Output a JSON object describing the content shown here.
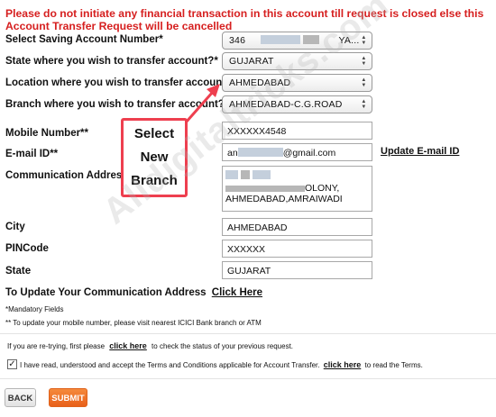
{
  "warning": "Please do not initiate any financial transaction in this account till request is closed else this Account Transfer Request will be cancelled",
  "form": {
    "saving_account_label": "Select Saving Account Number*",
    "saving_account_prefix": "346",
    "saving_account_suffix": "YA...",
    "state_label": "State where you wish to transfer account?*",
    "state_value": "GUJARAT",
    "location_label": "Location where you wish to transfer account?*",
    "location_value": "AHMEDABAD",
    "branch_label": "Branch where you wish to transfer account?*",
    "branch_value": "AHMEDABAD-C.G.ROAD",
    "mobile_label": "Mobile Number**",
    "mobile_value": "XXXXXX4548",
    "email_label": "E-mail ID**",
    "email_prefix": "an",
    "email_suffix": "@gmail.com",
    "update_email_link": "Update E-mail ID",
    "address_label": "Communication Address",
    "address_line": "AHMEDABAD,AMRAIWADI",
    "address_fragment": "OLONY,",
    "city_label": "City",
    "city_value": "AHMEDABAD",
    "pincode_label": "PINCode",
    "pincode_value": "XXXXXX",
    "state2_label": "State",
    "state2_value": "GUJARAT",
    "update_address_text": "To Update Your Communication Address",
    "update_address_link": "Click Here"
  },
  "notes": {
    "mandatory": "*Mandatory Fields",
    "mobile_note": "** To update your mobile number, please visit nearest ICICI Bank branch or ATM",
    "retry_before": "If you are re-trying, first please",
    "retry_link": "click here",
    "retry_after": "to check the status of your previous request.",
    "terms_before": "I have read, understood and accept the Terms and Conditions applicable for Account Transfer.",
    "terms_link": "click here",
    "terms_after": "to read the Terms."
  },
  "callout": {
    "line1": "Select",
    "line2": "New",
    "line3": "Branch"
  },
  "watermark": "Alldigitaltricks.com",
  "buttons": {
    "back": "BACK",
    "submit": "SUBMIT"
  },
  "colors": {
    "warning": "#d62020",
    "callout_border": "#ee3f4f",
    "submit": "#e8601a"
  }
}
